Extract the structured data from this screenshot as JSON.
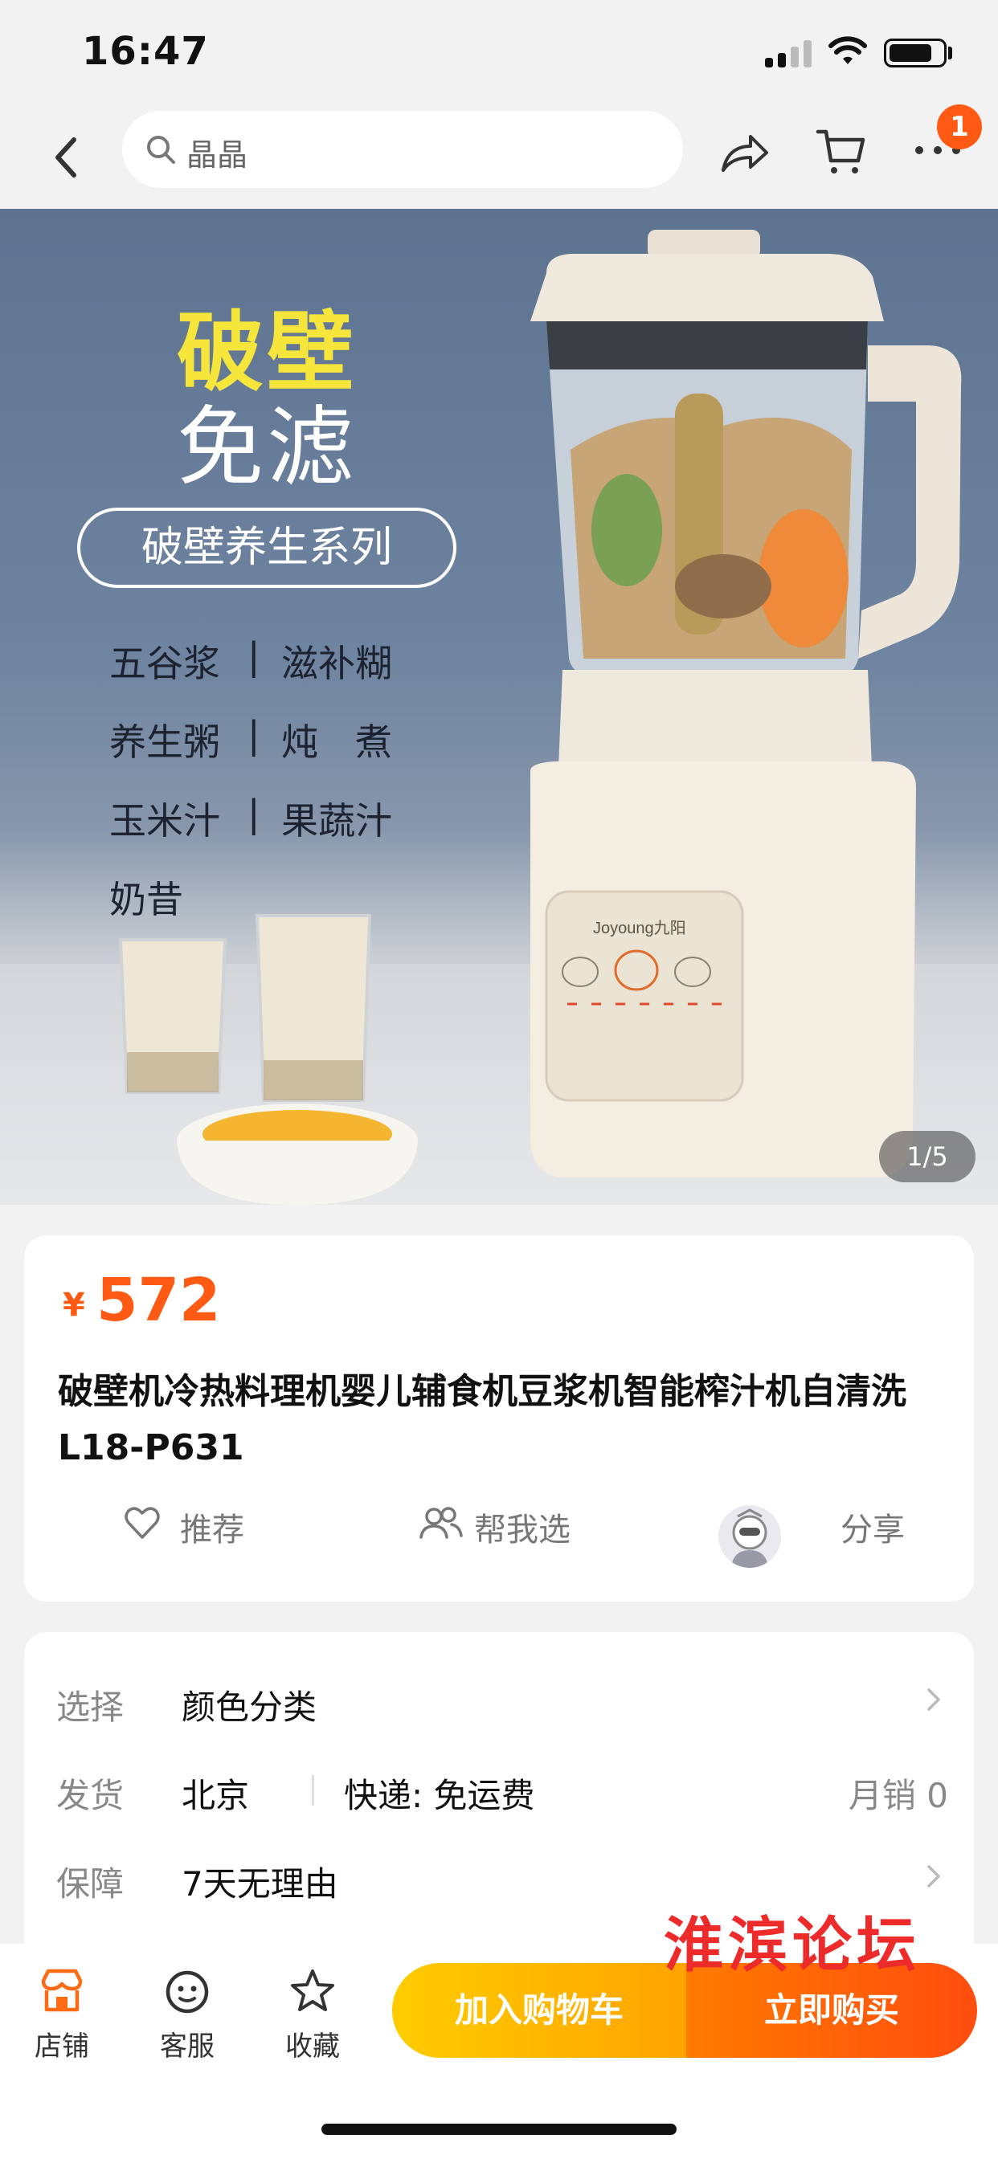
{
  "status_bar": {
    "time": "16:47"
  },
  "nav": {
    "search_text": "晶晶",
    "cart_badge": "1"
  },
  "hero": {
    "headline_1": "破壁",
    "headline_2": "免滤",
    "series_label": "破壁养生系列",
    "features": [
      {
        "left": "五谷浆",
        "sep": "|",
        "right": "滋补糊"
      },
      {
        "left": "养生粥",
        "sep": "|",
        "right": "炖　煮"
      },
      {
        "left": "玉米汁",
        "sep": "|",
        "right": "果蔬汁"
      },
      {
        "left": "奶昔",
        "sep": "",
        "right": ""
      }
    ],
    "brand_on_device": "Joyoung九阳",
    "image_counter": "1/5"
  },
  "product": {
    "currency": "¥",
    "price": "572",
    "title": "破壁机冷热料理机婴儿辅食机豆浆机智能榨汁机自清洗L18-P631",
    "actions": {
      "recommend": "推荐",
      "help_choose": "帮我选",
      "share": "分享"
    }
  },
  "info": {
    "select": {
      "key": "选择",
      "value": "颜色分类"
    },
    "ship": {
      "key": "发货",
      "location": "北京",
      "shipping": "快递: 免运费",
      "sales": "月销  0"
    },
    "guarantee": {
      "key": "保障",
      "value": "7天无理由"
    }
  },
  "bottom_bar": {
    "store": "店铺",
    "service": "客服",
    "favorite": "收藏",
    "add_to_cart": "加入购物车",
    "buy_now": "立即购买"
  },
  "watermark": "淮滨论坛",
  "colors": {
    "accent": "#ff5a14",
    "cart_button": "#ffb800",
    "buy_button": "#ff5a10",
    "headline_yellow": "#f6e53a"
  }
}
